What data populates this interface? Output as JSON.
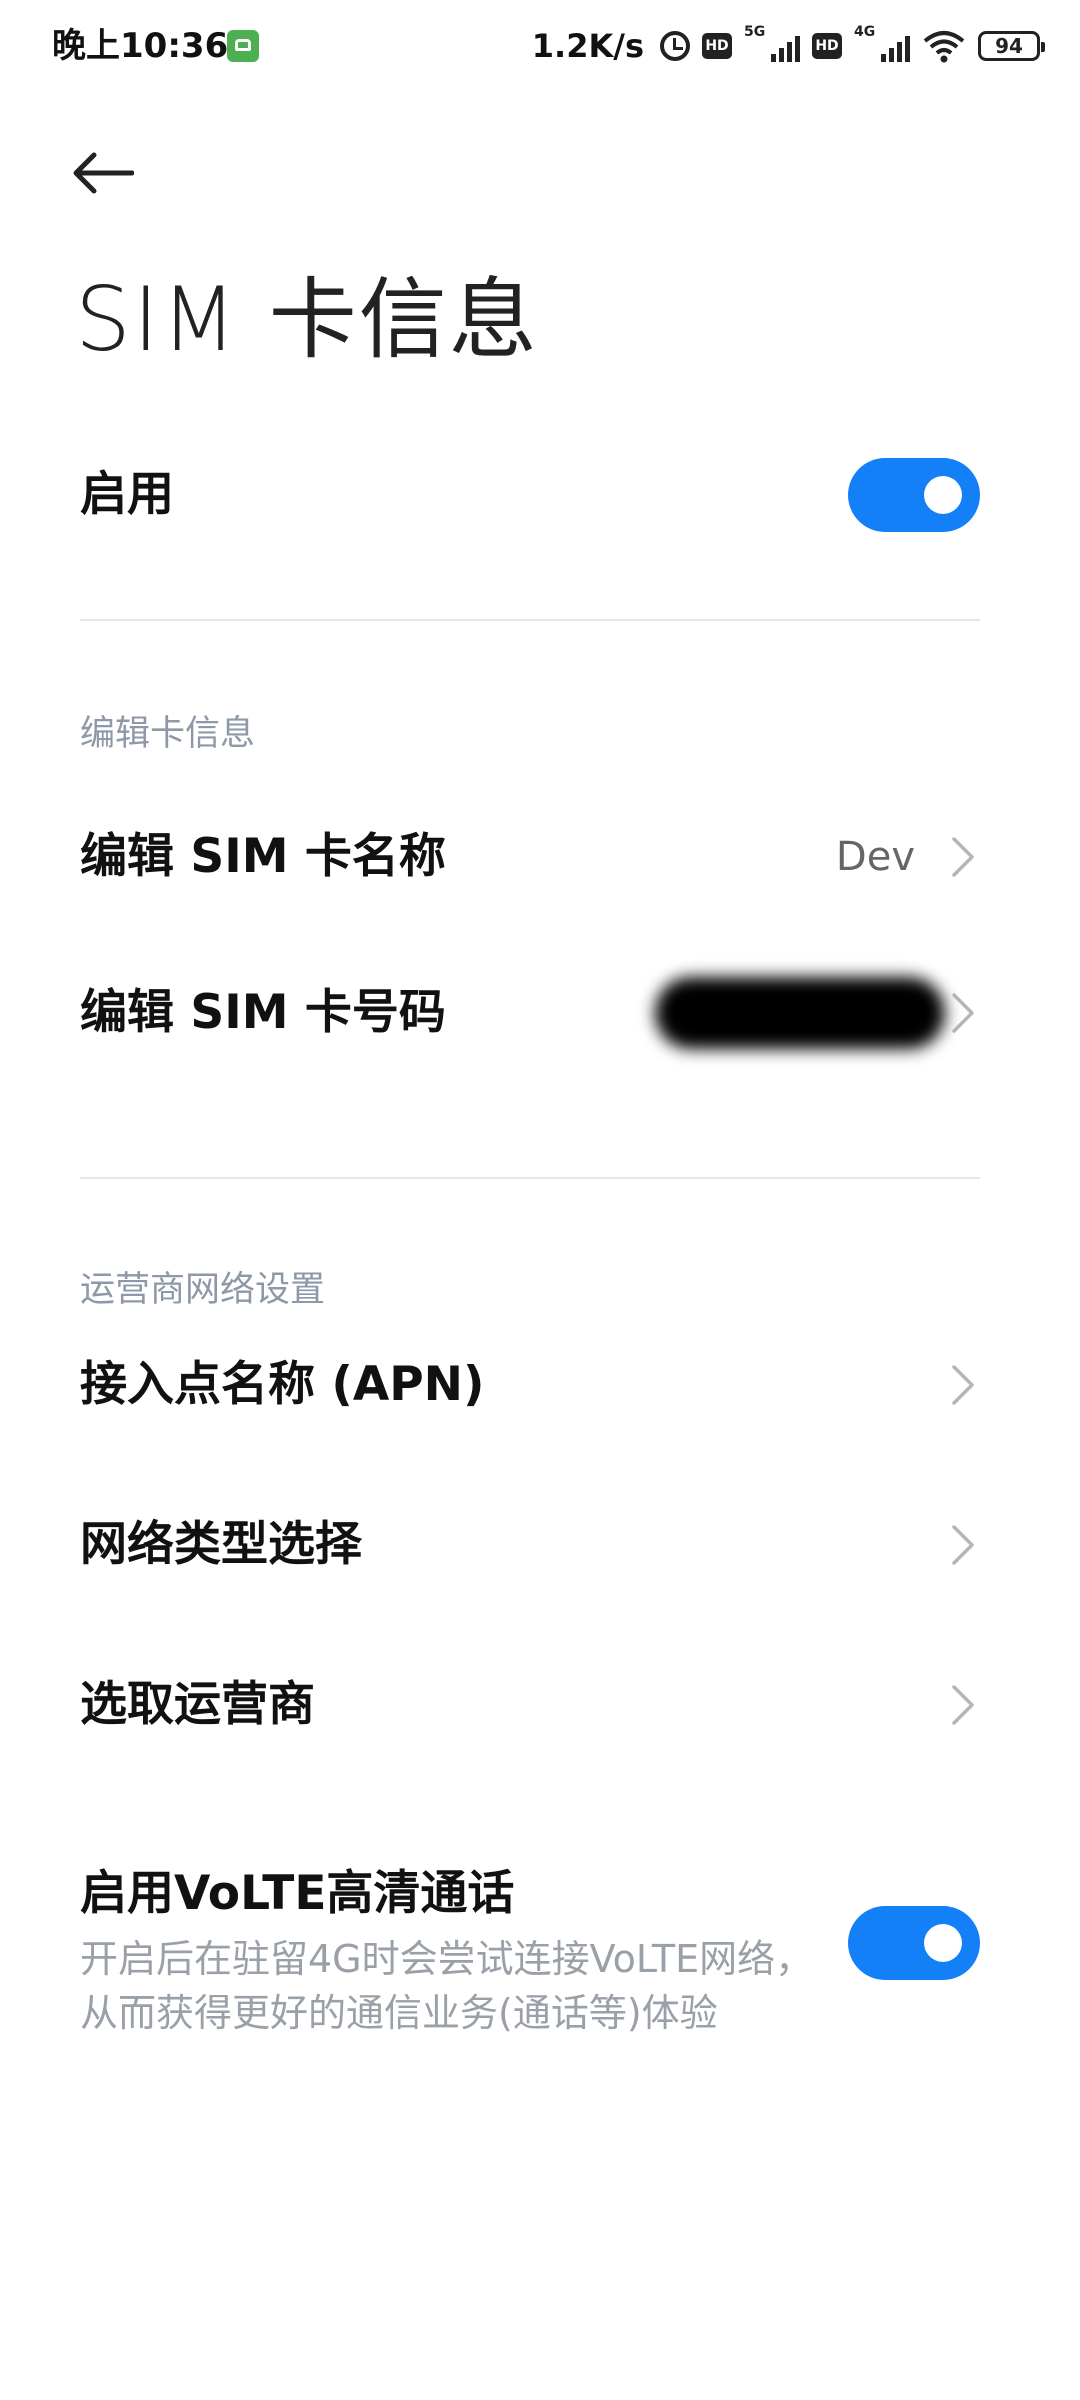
{
  "status_bar": {
    "time": "晚上10:36",
    "speed": "1.2K/s",
    "hd_badge_1": "HD",
    "hd_badge_2": "HD",
    "sim1_network": "5G",
    "sim2_network": "4G",
    "battery": "94",
    "icons": [
      "app-notification-icon",
      "alarm-icon",
      "hd-icon",
      "signal-icon",
      "hd-icon",
      "signal-icon",
      "wifi-icon",
      "battery-icon"
    ]
  },
  "header": {
    "back_icon": "arrow-left-icon",
    "title": "SIM 卡信息"
  },
  "enable": {
    "label": "启用",
    "on": true
  },
  "edit_section": {
    "header": "编辑卡信息",
    "items": [
      {
        "label": "编辑 SIM 卡名称",
        "value": "Dev"
      },
      {
        "label": "编辑 SIM 卡号码",
        "value": ""
      }
    ]
  },
  "carrier_section": {
    "header": "运营商网络设置",
    "items": [
      {
        "label": "接入点名称 (APN)"
      },
      {
        "label": "网络类型选择"
      },
      {
        "label": "选取运营商"
      }
    ]
  },
  "volte": {
    "label": "启用VoLTE高清通话",
    "description": "开启后在驻留4G时会尝试连接VoLTE网络，从而获得更好的通信业务(通话等)体验",
    "on": true
  },
  "colors": {
    "toggle_on": "#1480f8",
    "section_header": "#8e98a8",
    "description": "#9aa0a8"
  }
}
